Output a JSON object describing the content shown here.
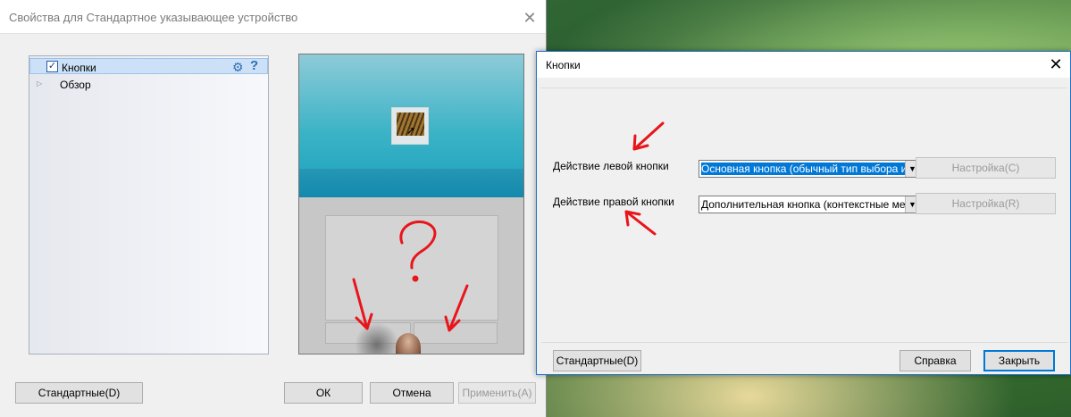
{
  "props_window": {
    "title": "Свойства для Стандартное указывающее устройство",
    "close_glyph": "✕",
    "tree": {
      "items": [
        {
          "label": "Кнопки",
          "checked": true,
          "check_glyph": "✓"
        },
        {
          "label": "Обзор",
          "expander_glyph": "▷"
        }
      ],
      "gear_glyph": "⚙",
      "help_glyph": "?"
    },
    "buttons": {
      "defaults": "Стандартные(D)",
      "ok": "ОК",
      "cancel": "Отмена",
      "apply": "Применить(A)"
    }
  },
  "buttons_dialog": {
    "title": "Кнопки",
    "close_glyph": "✕",
    "left_action_label": "Действие левой кнопки",
    "left_action_value": "Основная кнопка (обычный тип выбора и пе",
    "right_action_label": "Действие правой кнопки",
    "right_action_value": "Дополнительная кнопка (контекстные меню",
    "dropdown_glyph": "▼",
    "configure_left": "Настройка(C)",
    "configure_right": "Настройка(R)",
    "defaults": "Стандартные(D)",
    "help": "Справка",
    "close": "Закрыть"
  },
  "colors": {
    "accent": "#0078d7",
    "annotation": "#e8151b"
  }
}
